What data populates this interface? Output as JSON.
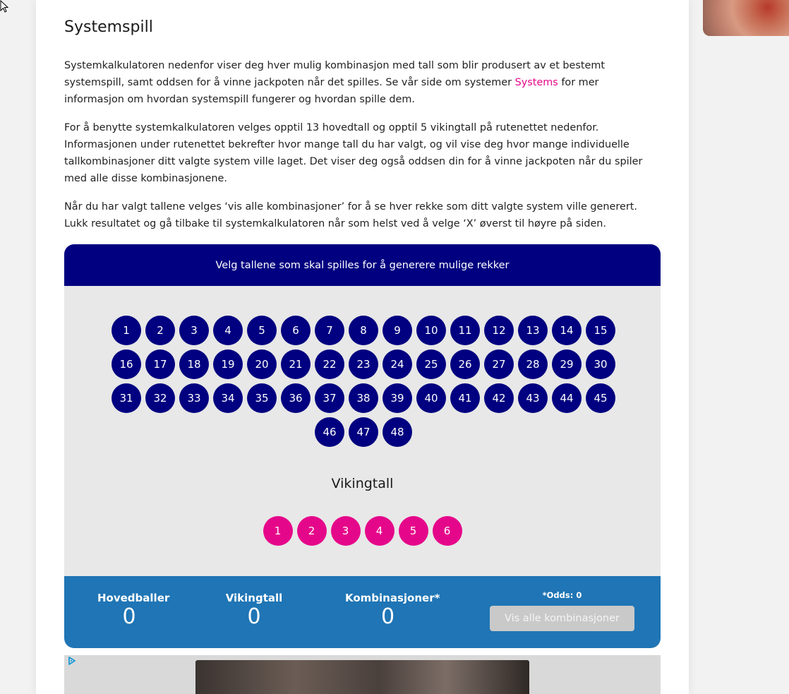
{
  "article": {
    "title": "Systemspill",
    "p1_before": "Systemkalkulatoren nedenfor viser deg hver mulig kombinasjon med tall som blir produsert av et bestemt systemspill, samt oddsen for å vinne jackpoten når det spilles. Se vår side om systemer ",
    "p1_link": "Systems",
    "p1_after": " for mer informasjon om hvordan systemspill fungerer og hvordan spille dem.",
    "p2": "For å benytte systemkalkulatoren velges opptil 13 hovedtall og opptil 5 vikingtall på rutenettet nedenfor. Informasjonen under rutenettet bekrefter hvor mange tall du har valgt, og vil vise deg hvor mange individuelle tallkombinasjoner ditt valgte system ville laget. Det viser deg også oddsen din for å vinne jackpoten når du spiler med alle disse kombinasjonene.",
    "p3": "Når du har valgt tallene velges ‘vis alle kombinasjoner’ for å se hver rekke som ditt valgte system ville generert. Lukk resultatet og gå tilbake til systemkalkulatoren når som helst ved å velge ‘X’ øverst til høyre på siden."
  },
  "calculator": {
    "header": "Velg tallene som skal spilles for å generere mulige rekker",
    "main_numbers": [
      "1",
      "2",
      "3",
      "4",
      "5",
      "6",
      "7",
      "8",
      "9",
      "10",
      "11",
      "12",
      "13",
      "14",
      "15",
      "16",
      "17",
      "18",
      "19",
      "20",
      "21",
      "22",
      "23",
      "24",
      "25",
      "26",
      "27",
      "28",
      "29",
      "30",
      "31",
      "32",
      "33",
      "34",
      "35",
      "36",
      "37",
      "38",
      "39",
      "40",
      "41",
      "42",
      "43",
      "44",
      "45",
      "46",
      "47",
      "48"
    ],
    "viking_title": "Vikingtall",
    "viking_numbers": [
      "1",
      "2",
      "3",
      "4",
      "5",
      "6"
    ],
    "stats": {
      "hoved_label": "Hovedballer",
      "hoved_value": "0",
      "viking_label": "Vikingtall",
      "viking_value": "0",
      "komb_label": "Kombinasjoner*",
      "komb_value": "0"
    },
    "odds": "*Odds: 0",
    "show_all_button": "Vis alle kombinasjoner"
  },
  "colors": {
    "main_ball": "#000080",
    "viking_ball": "#e5078a",
    "footer": "#1f75b5",
    "link": "#e5078a"
  },
  "icons": [
    "cursor-icon",
    "adchoices-icon"
  ]
}
